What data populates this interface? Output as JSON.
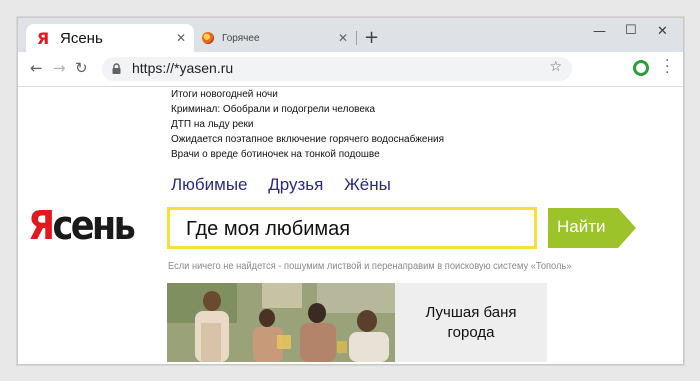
{
  "browser": {
    "tabs": [
      {
        "title": "Ясень",
        "icon": "yasen-favicon",
        "active": true
      },
      {
        "title": "Горячее",
        "icon": "hot-favicon",
        "active": false
      }
    ],
    "new_tab_label": "+",
    "url": "https://*yasen.ru",
    "window_controls": [
      "minimize-icon",
      "maximize-icon",
      "close-icon"
    ]
  },
  "news": [
    "Итоги новогодней ночи",
    "Криминал: Обобрали и подогрели человека",
    "ДТП на льду реки",
    "Ожидается поэтапное включение горячего водоснабжения",
    "Врачи о вреде ботиночек на тонкой подошве"
  ],
  "nav_links": [
    "Любимые",
    "Друзья",
    "Жёны"
  ],
  "logo": {
    "first_letter": "Я",
    "rest": "сень"
  },
  "search": {
    "value": "Где моя любимая",
    "button_label": "Найти"
  },
  "note": "Если ничего не найдется - пошумим листвой и перенаправим в поисковую систему «Тополь»",
  "ad": {
    "text_line1": "Лучшая баня",
    "text_line2": "города"
  },
  "colors": {
    "accent_red": "#e3181e",
    "link": "#2b2a7e",
    "search_border": "#f7e03c",
    "button_green": "#9cc32a"
  }
}
